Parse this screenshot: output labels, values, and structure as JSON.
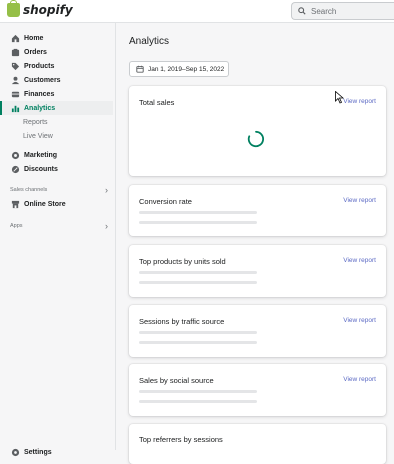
{
  "topbar": {
    "logo_text": "shopify",
    "search_placeholder": "Search"
  },
  "sidebar": {
    "items": [
      {
        "label": "Home",
        "icon": "home-icon"
      },
      {
        "label": "Orders",
        "icon": "orders-icon"
      },
      {
        "label": "Products",
        "icon": "tag-icon"
      },
      {
        "label": "Customers",
        "icon": "customers-icon"
      },
      {
        "label": "Finances",
        "icon": "finances-icon"
      },
      {
        "label": "Analytics",
        "icon": "analytics-icon",
        "active": true
      },
      {
        "label": "Marketing",
        "icon": "marketing-icon"
      },
      {
        "label": "Discounts",
        "icon": "discount-icon"
      }
    ],
    "analytics_sub": [
      "Reports",
      "Live View"
    ],
    "sales_channels_header": "Sales channels",
    "online_store": "Online Store",
    "apps_header": "Apps",
    "settings": "Settings"
  },
  "main": {
    "title": "Analytics",
    "date_range": "Jan 1, 2019–Sep 15, 2022",
    "cards": [
      {
        "title": "Total sales",
        "link": "View report"
      },
      {
        "title": "Conversion rate",
        "link": "View report"
      },
      {
        "title": "Top products by units sold",
        "link": "View report"
      },
      {
        "title": "Sessions by traffic source",
        "link": "View report"
      },
      {
        "title": "Sales by social source",
        "link": "View report"
      },
      {
        "title": "Top referrers by sessions",
        "link": ""
      }
    ]
  },
  "colors": {
    "accent": "#008060",
    "link": "#5c6ac4",
    "skeleton": "#e4e5e7"
  }
}
